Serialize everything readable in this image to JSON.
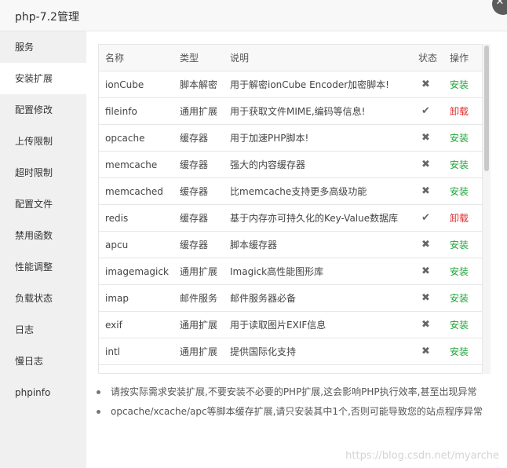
{
  "window": {
    "title": "php-7.2管理"
  },
  "sidebar": {
    "items": [
      {
        "label": "服务",
        "active": false
      },
      {
        "label": "安装扩展",
        "active": true
      },
      {
        "label": "配置修改",
        "active": false
      },
      {
        "label": "上传限制",
        "active": false
      },
      {
        "label": "超时限制",
        "active": false
      },
      {
        "label": "配置文件",
        "active": false
      },
      {
        "label": "禁用函数",
        "active": false
      },
      {
        "label": "性能调整",
        "active": false
      },
      {
        "label": "负载状态",
        "active": false
      },
      {
        "label": "日志",
        "active": false
      },
      {
        "label": "慢日志",
        "active": false
      },
      {
        "label": "phpinfo",
        "active": false
      }
    ]
  },
  "table": {
    "headers": {
      "name": "名称",
      "type": "类型",
      "desc": "说明",
      "status": "状态",
      "action": "操作"
    },
    "rows": [
      {
        "name": "ionCube",
        "type": "脚本解密",
        "desc": "用于解密ionCube Encoder加密脚本!",
        "status": "✖",
        "action": "安装",
        "installed": false
      },
      {
        "name": "fileinfo",
        "type": "通用扩展",
        "desc": "用于获取文件MIME,编码等信息!",
        "status": "✔",
        "action": "卸载",
        "installed": true
      },
      {
        "name": "opcache",
        "type": "缓存器",
        "desc": "用于加速PHP脚本!",
        "status": "✖",
        "action": "安装",
        "installed": false
      },
      {
        "name": "memcache",
        "type": "缓存器",
        "desc": "强大的内容缓存器",
        "status": "✖",
        "action": "安装",
        "installed": false
      },
      {
        "name": "memcached",
        "type": "缓存器",
        "desc": "比memcache支持更多高级功能",
        "status": "✖",
        "action": "安装",
        "installed": false
      },
      {
        "name": "redis",
        "type": "缓存器",
        "desc": "基于内存亦可持久化的Key-Value数据库",
        "status": "✔",
        "action": "卸载",
        "installed": true
      },
      {
        "name": "apcu",
        "type": "缓存器",
        "desc": "脚本缓存器",
        "status": "✖",
        "action": "安装",
        "installed": false
      },
      {
        "name": "imagemagick",
        "type": "通用扩展",
        "desc": "Imagick高性能图形库",
        "status": "✖",
        "action": "安装",
        "installed": false
      },
      {
        "name": "imap",
        "type": "邮件服务",
        "desc": "邮件服务器必备",
        "status": "✖",
        "action": "安装",
        "installed": false
      },
      {
        "name": "exif",
        "type": "通用扩展",
        "desc": "用于读取图片EXIF信息",
        "status": "✖",
        "action": "安装",
        "installed": false
      },
      {
        "name": "intl",
        "type": "通用扩展",
        "desc": "提供国际化支持",
        "status": "✖",
        "action": "安装",
        "installed": false
      }
    ]
  },
  "notes": [
    "请按实际需求安装扩展,不要安装不必要的PHP扩展,这会影响PHP执行效率,甚至出现异常",
    "opcache/xcache/apc等脚本缓存扩展,请只安装其中1个,否则可能导致您的站点程序异常"
  ],
  "watermark": "https://blog.csdn.net/myarche",
  "colors": {
    "install": "#20a53a",
    "uninstall": "#e22c2c"
  }
}
